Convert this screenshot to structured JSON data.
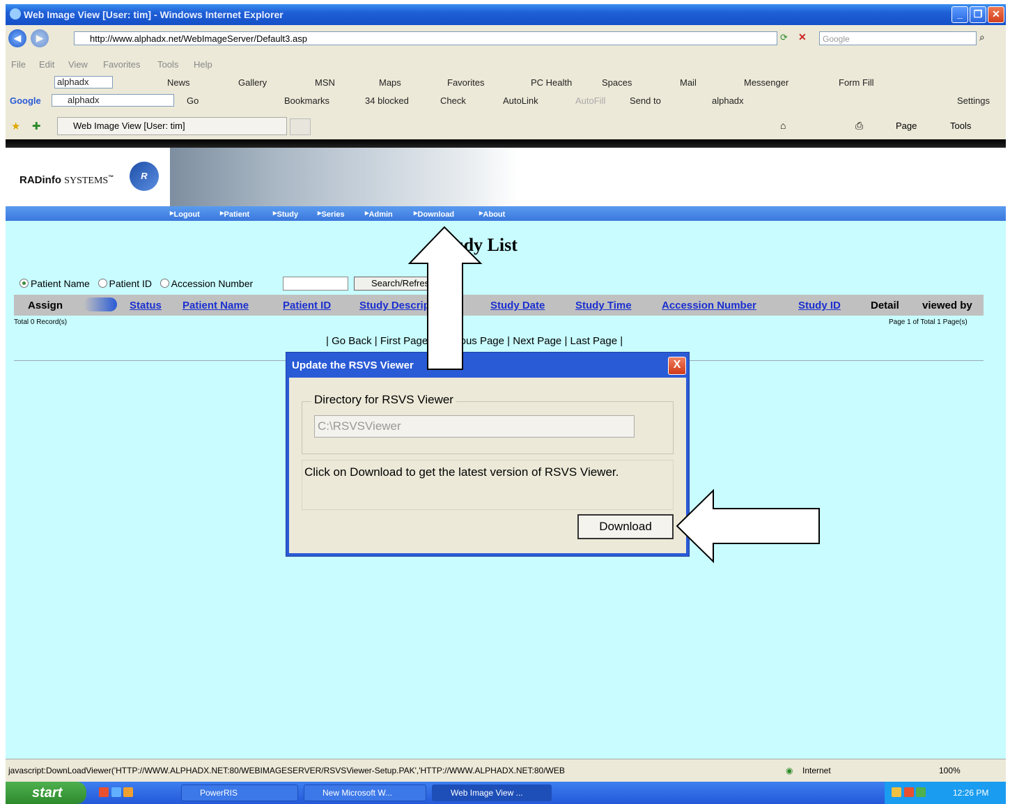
{
  "window": {
    "title": "Web Image View [User: tim] - Windows Internet Explorer"
  },
  "browser": {
    "address": "http://www.alphadx.net/WebImageServer/Default3.asp",
    "search_placeholder": "Google",
    "menu": [
      "File",
      "Edit",
      "View",
      "Favorites",
      "Tools",
      "Help"
    ],
    "toolbar1": {
      "search_value": "alphadx",
      "items": [
        "News",
        "Gallery",
        "MSN",
        "Maps",
        "Favorites",
        "PC Health",
        "Spaces",
        "Mail",
        "Messenger",
        "Form Fill"
      ]
    },
    "toolbar2": {
      "google_label": "Google",
      "search_value": "alphadx",
      "items": [
        "Go",
        "Bookmarks",
        "34 blocked",
        "Check",
        "AutoLink",
        "AutoFill",
        "Send to",
        "alphadx",
        "Settings"
      ]
    },
    "tab_title": "Web Image View [User: tim]",
    "tab_tools": [
      "Page",
      "Tools"
    ]
  },
  "app": {
    "logo_bold": "RADinfo",
    "logo_light": "SYSTEMS",
    "logo_tm": "™",
    "logo_mark": "R",
    "nav": [
      "Logout",
      "Patient",
      "Study",
      "Series",
      "Admin",
      "Download",
      "About"
    ],
    "page_title": "Study List",
    "search": {
      "options": [
        "Patient Name",
        "Patient ID",
        "Accession Number"
      ],
      "button": "Search/Refresh"
    },
    "columns": [
      "Assign",
      "Status",
      "Patient Name",
      "Patient ID",
      "Study Description",
      "Study Date",
      "Study Time",
      "Accession Number",
      "Study ID",
      "Detail",
      "viewed by"
    ],
    "total_records": "Total 0 Record(s)",
    "page_info": "Page 1 of Total 1 Page(s)",
    "pager": [
      "Go Back",
      "First Page",
      "Previous Page",
      "Next Page",
      "Last Page"
    ]
  },
  "dialog": {
    "title": "Update the RSVS Viewer",
    "close_label": "X",
    "legend": "Directory for RSVS Viewer",
    "directory": "C:\\RSVSViewer",
    "message": "Click on Download to get the latest version of RSVS Viewer.",
    "button": "Download"
  },
  "statusbar": {
    "text": "javascript:DownLoadViewer('HTTP://WWW.ALPHADX.NET:80/WEBIMAGESERVER/RSVSViewer-Setup.PAK','HTTP://WWW.ALPHADX.NET:80/WEB",
    "zone": "Internet",
    "zoom": "100%"
  },
  "taskbar": {
    "start": "start",
    "tasks": [
      "PowerRIS",
      "New Microsoft W...",
      "Web Image View ..."
    ],
    "clock": "12:26 PM"
  }
}
